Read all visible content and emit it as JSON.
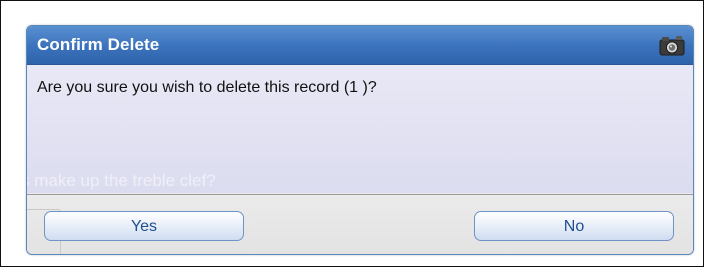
{
  "dialog": {
    "title": "Confirm Delete",
    "title_icon": "camera-icon",
    "message": "Are you sure you wish to delete this record (1 )?",
    "background_text": "s make up the treble clef?",
    "buttons": {
      "yes_label": "Yes",
      "no_label": "No"
    }
  },
  "colors": {
    "titlebar": "#3a72bc",
    "message_bg": "#e3e3f4",
    "button_text": "#1f4f8f"
  }
}
